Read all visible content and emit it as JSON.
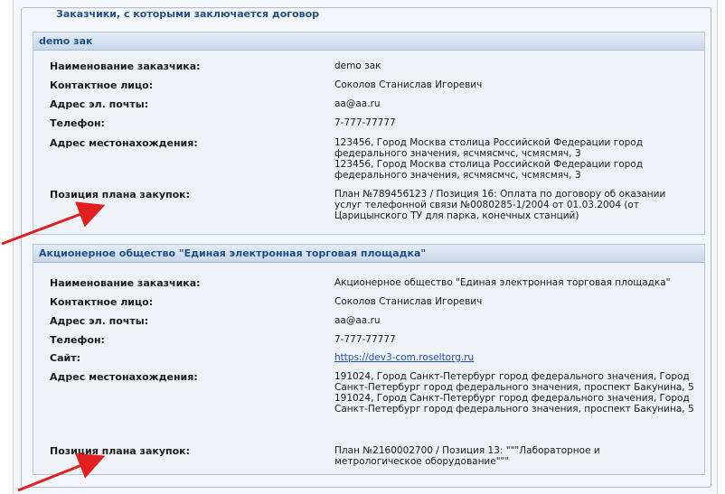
{
  "fieldset": {
    "legend": "Заказчики, с которыми заключается договор"
  },
  "customers": [
    {
      "header": "demo зак",
      "rows": [
        {
          "label": "Наименование заказчика:",
          "value": "demo зак"
        },
        {
          "label": "Контактное лицо:",
          "value": "Соколов Станислав Игоревич"
        },
        {
          "label": "Адрес эл. почты:",
          "value": "aa@aa.ru"
        },
        {
          "label": "Телефон:",
          "value": "7-777-77777"
        },
        {
          "label": "Адрес местонахождения:",
          "value": "123456, Город Москва столица Российской Федерации город федерального значения, ясчмясмчс, чсмясмяч, 3\n123456, Город Москва столица Российской Федерации город федерального значения, ясчмясмчс, чсмясмяч, 3"
        },
        {
          "label": "Позиция плана закупок:",
          "value": "План №789456123 / Позиция 16: Оплата по договору об оказании услуг телефонной связи №0080285-1/2004 от 01.03.2004 (от Царицынского ТУ для парка, конечных станций)"
        }
      ]
    },
    {
      "header": "Акционерное общество \"Единая электронная торговая площадка\"",
      "rows": [
        {
          "label": "Наименование заказчика:",
          "value": "Акционерное общество \"Единая электронная торговая площадка\""
        },
        {
          "label": "Контактное лицо:",
          "value": "Соколов Станислав Игоревич"
        },
        {
          "label": "Адрес эл. почты:",
          "value": "aa@aa.ru"
        },
        {
          "label": "Телефон:",
          "value": "7-777-77777"
        },
        {
          "label": "Сайт:",
          "value": "https://dev3-com.roseltorg.ru"
        },
        {
          "label": "Адрес местонахождения:",
          "value": "191024, Город Санкт-Петербург город федерального значения, Город Санкт-Петербург город федерального значения, проспект Бакунина, 5\n191024, Город Санкт-Петербург город федерального значения, Город Санкт-Петербург город федерального значения, проспект Бакунина, 5"
        },
        {
          "label": "Позиция плана закупок:",
          "value": "План №2160002700 / Позиция 13: \"\"\"Лабораторное и метрологическое оборудование\"\"\""
        }
      ]
    }
  ],
  "colors": {
    "header_text": "#1f4f8a",
    "link": "#1a4fb4",
    "arrow": "#e02020"
  }
}
